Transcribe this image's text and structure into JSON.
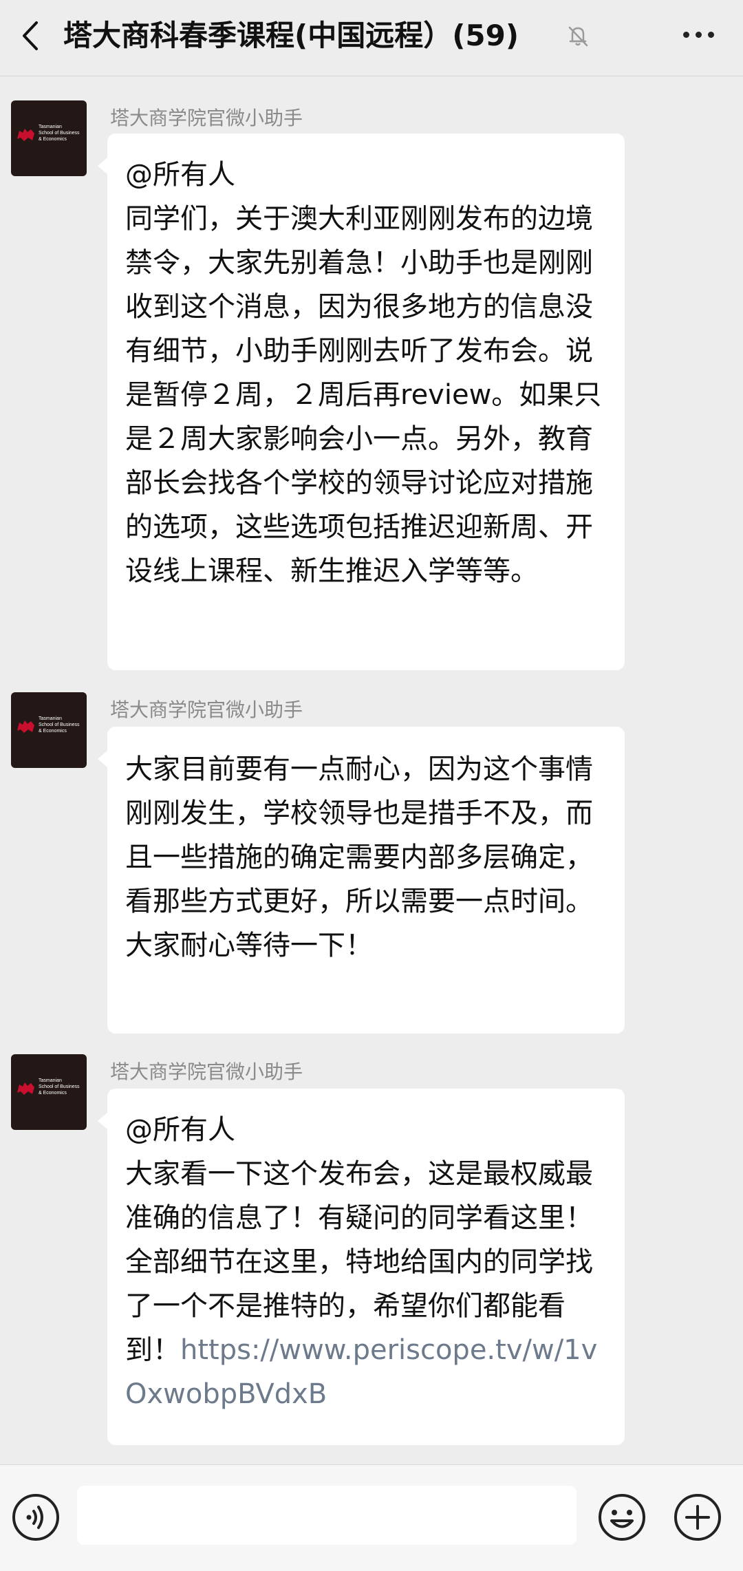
{
  "header": {
    "back_icon": "chevron-left-icon",
    "title": "塔大商科春季课程(中国远程）(59)",
    "mute_icon": "bell-off-icon",
    "more_icon": "ellipsis-icon"
  },
  "avatar": {
    "brand_lines": [
      "Tasmanian",
      "School of Business",
      "& Economics"
    ]
  },
  "messages": [
    {
      "sender": "塔大商学院官微小助手",
      "text": "@所有人\n同学们，关于澳大利亚刚刚发布的边境禁令，大家先别着急！小助手也是刚刚收到这个消息，因为很多地方的信息没有细节，小助手刚刚去听了发布会。说是暂停２周，２周后再review。如果只是２周大家影响会小一点。另外，教育部长会找各个学校的领导讨论应对措施的选项，这些选项包括推迟迎新周、开设线上课程、新生推迟入学等等。"
    },
    {
      "sender": "塔大商学院官微小助手",
      "text": "大家目前要有一点耐心，因为这个事情刚刚发生，学校领导也是措手不及，而且一些措施的确定需要内部多层确定，看那些方式更好，所以需要一点时间。大家耐心等待一下！"
    },
    {
      "sender": "塔大商学院官微小助手",
      "text": "@所有人\n大家看一下这个发布会，这是最权威最准确的信息了！有疑问的同学看这里！全部细节在这里，特地给国内的同学找了一个不是推特的，希望你们都能看到！",
      "link": "https://www.periscope.tv/w/1vOxwobpBVdxB"
    }
  ],
  "bottom_bar": {
    "voice_icon": "voice-icon",
    "emoji_icon": "emoji-icon",
    "plus_icon": "plus-circle-icon"
  },
  "colors": {
    "background": "#ededed",
    "bubble": "#ffffff",
    "link": "#6d7a8b",
    "sender": "#8a8a8a"
  }
}
